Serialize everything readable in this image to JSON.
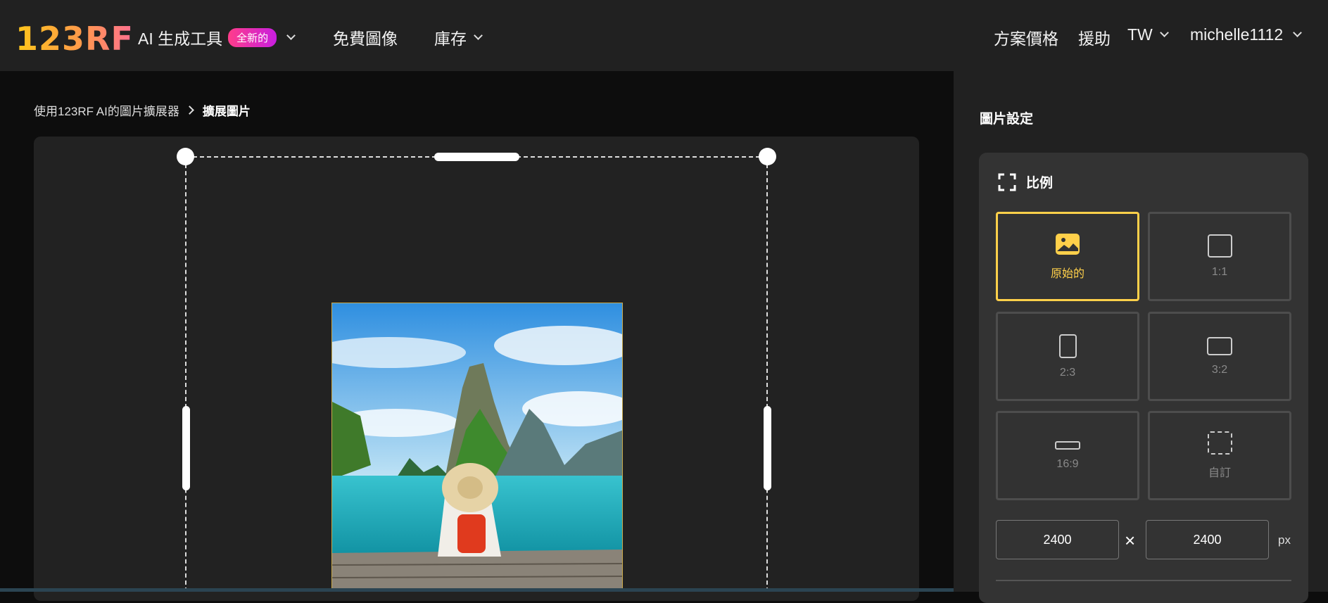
{
  "header": {
    "logo": "123RF",
    "nav": [
      {
        "label": "AI 生成工具",
        "badge": "全新的"
      },
      {
        "label": "免費圖像"
      },
      {
        "label": "庫存"
      }
    ],
    "right": {
      "pricing": "方案價格",
      "help": "援助",
      "language": "TW",
      "user": "michelle1112"
    }
  },
  "breadcrumb": {
    "parent": "使用123RF AI的圖片擴展器",
    "current": "擴展圖片"
  },
  "sidebar": {
    "title": "圖片設定",
    "ratio_label": "比例",
    "ratios": [
      {
        "label": "原始的",
        "icon": "image-icon",
        "selected": true
      },
      {
        "label": "1:1",
        "icon": "square-icon"
      },
      {
        "label": "2:3",
        "icon": "portrait-icon"
      },
      {
        "label": "3:2",
        "icon": "landscape-icon"
      },
      {
        "label": "16:9",
        "icon": "widescreen-icon"
      },
      {
        "label": "自訂",
        "icon": "custom-dashed-icon"
      }
    ],
    "width": "2400",
    "height": "2400",
    "times": "×",
    "unit": "px"
  },
  "colors": {
    "accent": "#ffd04a",
    "badge": "#e0249c"
  }
}
